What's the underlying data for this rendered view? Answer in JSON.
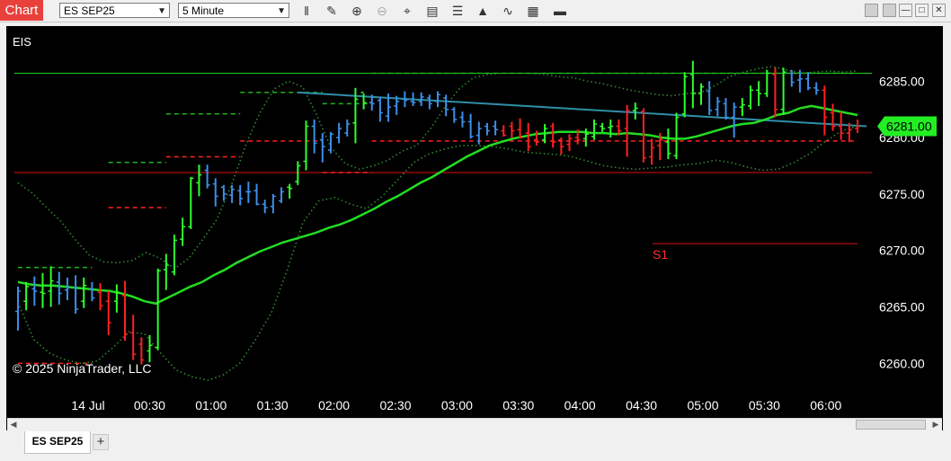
{
  "window": {
    "chart_label": "Chart",
    "instrument": "ES SEP25",
    "interval": "5 Minute",
    "toolbar_icons": [
      "bar-type-icon",
      "draw-pencil-icon",
      "zoom-in-icon",
      "zoom-out-icon",
      "crosshair-icon",
      "data-box-icon",
      "properties-icon",
      "indicators-icon",
      "strategies-icon",
      "templates-icon",
      "overlay-icon"
    ],
    "win_buttons": [
      "minimize",
      "maximize",
      "close"
    ]
  },
  "chart": {
    "instrument_label": "EIS",
    "copyright": "© 2025 NinjaTrader, LLC",
    "current_price": "6281.00",
    "price_ticks": [
      "6285.00",
      "6280.00",
      "6275.00",
      "6270.00",
      "6265.00",
      "6260.00"
    ],
    "time_ticks": [
      "14 Jul",
      "00:30",
      "01:00",
      "01:30",
      "02:00",
      "02:30",
      "03:00",
      "03:30",
      "04:00",
      "04:30",
      "05:00",
      "05:30",
      "06:00"
    ],
    "level_label": "S1",
    "colors": {
      "up": "#2eff2e",
      "down": "#ff2020",
      "neutral": "#3d8ee8",
      "ma": "#22dd22",
      "band": "#2f8a2f",
      "trend": "#2f8fa8",
      "hline": "#d11",
      "badge": "#22ee22"
    }
  },
  "chart_data": {
    "type": "candlestick",
    "y_range": [
      6257.4,
      6289.8
    ],
    "bar_count": 69,
    "bars": [
      {
        "o": 6264.6,
        "h": 6266.8,
        "l": 6262.9,
        "c": 6266.4,
        "d": "neutral"
      },
      {
        "o": 6265.5,
        "h": 6267.2,
        "l": 6264.7,
        "c": 6266.8,
        "d": "up"
      },
      {
        "o": 6266.6,
        "h": 6267.7,
        "l": 6265.1,
        "c": 6266.4,
        "d": "neutral"
      },
      {
        "o": 6266.3,
        "h": 6268.0,
        "l": 6264.9,
        "c": 6266.2,
        "d": "up"
      },
      {
        "o": 6266.4,
        "h": 6268.6,
        "l": 6265.0,
        "c": 6267.3,
        "d": "up"
      },
      {
        "o": 6267.2,
        "h": 6268.1,
        "l": 6265.2,
        "c": 6266.2,
        "d": "neutral"
      },
      {
        "o": 6266.5,
        "h": 6267.6,
        "l": 6265.6,
        "c": 6266.7,
        "d": "neutral"
      },
      {
        "o": 6266.7,
        "h": 6267.8,
        "l": 6264.4,
        "c": 6264.8,
        "d": "neutral"
      },
      {
        "o": 6265.5,
        "h": 6267.6,
        "l": 6264.9,
        "c": 6266.9,
        "d": "up"
      },
      {
        "o": 6266.6,
        "h": 6267.2,
        "l": 6265.5,
        "c": 6265.8,
        "d": "neutral"
      },
      {
        "o": 6266.3,
        "h": 6267.1,
        "l": 6264.7,
        "c": 6265.1,
        "d": "down"
      },
      {
        "o": 6265.5,
        "h": 6266.4,
        "l": 6262.5,
        "c": 6263.6,
        "d": "down"
      },
      {
        "o": 6265.5,
        "h": 6267.0,
        "l": 6264.5,
        "c": 6266.3,
        "d": "up"
      },
      {
        "o": 6266.0,
        "h": 6267.3,
        "l": 6262.0,
        "c": 6262.6,
        "d": "down"
      },
      {
        "o": 6262.7,
        "h": 6264.3,
        "l": 6260.3,
        "c": 6260.8,
        "d": "down"
      },
      {
        "o": 6261.7,
        "h": 6262.3,
        "l": 6259.9,
        "c": 6260.3,
        "d": "down"
      },
      {
        "o": 6261.1,
        "h": 6262.5,
        "l": 6260.1,
        "c": 6261.6,
        "d": "up"
      },
      {
        "o": 6261.4,
        "h": 6268.4,
        "l": 6261.2,
        "c": 6268.2,
        "d": "up"
      },
      {
        "o": 6268.3,
        "h": 6269.7,
        "l": 6266.5,
        "c": 6268.7,
        "d": "up"
      },
      {
        "o": 6268.1,
        "h": 6271.4,
        "l": 6267.8,
        "c": 6270.9,
        "d": "up"
      },
      {
        "o": 6271.0,
        "h": 6272.9,
        "l": 6270.4,
        "c": 6272.1,
        "d": "up"
      },
      {
        "o": 6272.1,
        "h": 6276.5,
        "l": 6271.9,
        "c": 6276.4,
        "d": "up"
      },
      {
        "o": 6276.0,
        "h": 6277.6,
        "l": 6274.8,
        "c": 6276.7,
        "d": "up"
      },
      {
        "o": 6277.1,
        "h": 6277.6,
        "l": 6275.5,
        "c": 6275.8,
        "d": "neutral"
      },
      {
        "o": 6275.9,
        "h": 6276.4,
        "l": 6273.9,
        "c": 6274.8,
        "d": "neutral"
      },
      {
        "o": 6275.6,
        "h": 6275.8,
        "l": 6274.4,
        "c": 6275.0,
        "d": "neutral"
      },
      {
        "o": 6274.9,
        "h": 6275.8,
        "l": 6274.2,
        "c": 6275.4,
        "d": "neutral"
      },
      {
        "o": 6275.3,
        "h": 6275.8,
        "l": 6274.0,
        "c": 6274.6,
        "d": "neutral"
      },
      {
        "o": 6275.2,
        "h": 6276.1,
        "l": 6274.2,
        "c": 6275.2,
        "d": "neutral"
      },
      {
        "o": 6275.3,
        "h": 6275.9,
        "l": 6274.0,
        "c": 6274.1,
        "d": "neutral"
      },
      {
        "o": 6274.1,
        "h": 6274.5,
        "l": 6273.3,
        "c": 6273.8,
        "d": "neutral"
      },
      {
        "o": 6273.9,
        "h": 6275.0,
        "l": 6273.3,
        "c": 6274.8,
        "d": "neutral"
      },
      {
        "o": 6274.4,
        "h": 6275.6,
        "l": 6274.2,
        "c": 6275.2,
        "d": "neutral"
      },
      {
        "o": 6275.6,
        "h": 6275.9,
        "l": 6274.6,
        "c": 6275.5,
        "d": "up"
      },
      {
        "o": 6276.1,
        "h": 6277.9,
        "l": 6275.8,
        "c": 6277.5,
        "d": "up"
      },
      {
        "o": 6277.9,
        "h": 6281.5,
        "l": 6277.1,
        "c": 6281.0,
        "d": "up"
      },
      {
        "o": 6281.0,
        "h": 6281.6,
        "l": 6278.6,
        "c": 6279.5,
        "d": "neutral"
      },
      {
        "o": 6279.8,
        "h": 6280.4,
        "l": 6277.8,
        "c": 6279.2,
        "d": "neutral"
      },
      {
        "o": 6278.9,
        "h": 6280.5,
        "l": 6278.6,
        "c": 6280.3,
        "d": "neutral"
      },
      {
        "o": 6280.0,
        "h": 6281.3,
        "l": 6279.5,
        "c": 6280.8,
        "d": "neutral"
      },
      {
        "o": 6280.4,
        "h": 6281.6,
        "l": 6280.1,
        "c": 6281.2,
        "d": "neutral"
      },
      {
        "o": 6281.3,
        "h": 6284.4,
        "l": 6279.5,
        "c": 6283.4,
        "d": "up"
      },
      {
        "o": 6284.0,
        "h": 6283.9,
        "l": 6282.5,
        "c": 6283.1,
        "d": "up"
      },
      {
        "o": 6283.1,
        "h": 6283.8,
        "l": 6282.4,
        "c": 6283.0,
        "d": "neutral"
      },
      {
        "o": 6283.3,
        "h": 6283.6,
        "l": 6281.4,
        "c": 6282.2,
        "d": "neutral"
      },
      {
        "o": 6281.9,
        "h": 6283.9,
        "l": 6281.4,
        "c": 6282.7,
        "d": "neutral"
      },
      {
        "o": 6282.8,
        "h": 6283.7,
        "l": 6282.0,
        "c": 6283.2,
        "d": "neutral"
      },
      {
        "o": 6283.4,
        "h": 6284.1,
        "l": 6282.7,
        "c": 6283.3,
        "d": "neutral"
      },
      {
        "o": 6283.2,
        "h": 6284.0,
        "l": 6282.8,
        "c": 6283.1,
        "d": "neutral"
      },
      {
        "o": 6283.2,
        "h": 6284.0,
        "l": 6282.8,
        "c": 6283.6,
        "d": "neutral"
      },
      {
        "o": 6283.5,
        "h": 6283.8,
        "l": 6282.5,
        "c": 6283.0,
        "d": "neutral"
      },
      {
        "o": 6283.2,
        "h": 6284.1,
        "l": 6282.7,
        "c": 6283.8,
        "d": "neutral"
      },
      {
        "o": 6283.5,
        "h": 6283.8,
        "l": 6281.9,
        "c": 6282.5,
        "d": "neutral"
      },
      {
        "o": 6282.5,
        "h": 6282.7,
        "l": 6281.3,
        "c": 6281.6,
        "d": "neutral"
      },
      {
        "o": 6281.8,
        "h": 6282.3,
        "l": 6280.9,
        "c": 6281.4,
        "d": "neutral"
      },
      {
        "o": 6281.4,
        "h": 6282.1,
        "l": 6279.9,
        "c": 6280.1,
        "d": "neutral"
      },
      {
        "o": 6280.2,
        "h": 6281.4,
        "l": 6279.4,
        "c": 6280.8,
        "d": "neutral"
      },
      {
        "o": 6281.0,
        "h": 6281.3,
        "l": 6280.2,
        "c": 6280.6,
        "d": "neutral"
      },
      {
        "o": 6281.0,
        "h": 6281.5,
        "l": 6280.2,
        "c": 6280.7,
        "d": "neutral"
      },
      {
        "o": 6280.6,
        "h": 6281.1,
        "l": 6280.1,
        "c": 6280.2,
        "d": "down"
      },
      {
        "o": 6281.0,
        "h": 6281.4,
        "l": 6280.0,
        "c": 6280.6,
        "d": "down"
      },
      {
        "o": 6280.7,
        "h": 6281.7,
        "l": 6279.9,
        "c": 6280.0,
        "d": "down"
      },
      {
        "o": 6280.4,
        "h": 6281.3,
        "l": 6278.8,
        "c": 6279.2,
        "d": "down"
      },
      {
        "o": 6279.8,
        "h": 6280.6,
        "l": 6279.3,
        "c": 6279.6,
        "d": "down"
      },
      {
        "o": 6279.8,
        "h": 6281.2,
        "l": 6279.5,
        "c": 6280.8,
        "d": "up"
      },
      {
        "o": 6281.0,
        "h": 6281.3,
        "l": 6279.1,
        "c": 6279.6,
        "d": "down"
      },
      {
        "o": 6279.8,
        "h": 6280.0,
        "l": 6278.5,
        "c": 6279.2,
        "d": "down"
      },
      {
        "o": 6279.4,
        "h": 6280.3,
        "l": 6278.8,
        "c": 6279.9,
        "d": "down"
      },
      {
        "o": 6280.0,
        "h": 6280.7,
        "l": 6279.4,
        "c": 6279.8,
        "d": "down"
      }
    ],
    "bars2": [
      {
        "o": 6279.9,
        "h": 6280.8,
        "l": 6279.2,
        "c": 6280.3,
        "d": "up"
      },
      {
        "o": 6280.1,
        "h": 6281.6,
        "l": 6279.8,
        "c": 6281.2,
        "d": "up"
      },
      {
        "o": 6281.0,
        "h": 6281.3,
        "l": 6280.5,
        "c": 6280.8,
        "d": "up"
      },
      {
        "o": 6280.9,
        "h": 6281.6,
        "l": 6280.0,
        "c": 6281.0,
        "d": "up"
      },
      {
        "o": 6281.0,
        "h": 6281.6,
        "l": 6280.2,
        "c": 6280.6,
        "d": "down"
      },
      {
        "o": 6280.8,
        "h": 6282.9,
        "l": 6278.3,
        "c": 6282.4,
        "d": "down"
      },
      {
        "o": 6282.4,
        "h": 6283.1,
        "l": 6281.6,
        "c": 6282.6,
        "d": "up"
      },
      {
        "o": 6282.3,
        "h": 6282.6,
        "l": 6277.8,
        "c": 6278.2,
        "d": "down"
      },
      {
        "o": 6278.3,
        "h": 6279.9,
        "l": 6277.6,
        "c": 6279.1,
        "d": "down"
      },
      {
        "o": 6279.3,
        "h": 6280.4,
        "l": 6278.0,
        "c": 6279.8,
        "d": "down"
      },
      {
        "o": 6279.6,
        "h": 6280.8,
        "l": 6278.1,
        "c": 6278.6,
        "d": "up"
      },
      {
        "o": 6278.4,
        "h": 6282.2,
        "l": 6278.1,
        "c": 6281.8,
        "d": "up"
      },
      {
        "o": 6282.1,
        "h": 6285.8,
        "l": 6281.8,
        "c": 6285.4,
        "d": "up"
      },
      {
        "o": 6285.6,
        "h": 6286.8,
        "l": 6282.6,
        "c": 6283.9,
        "d": "up"
      },
      {
        "o": 6283.9,
        "h": 6284.8,
        "l": 6282.9,
        "c": 6284.5,
        "d": "up"
      },
      {
        "o": 6284.1,
        "h": 6285.0,
        "l": 6282.0,
        "c": 6282.4,
        "d": "neutral"
      },
      {
        "o": 6282.5,
        "h": 6283.6,
        "l": 6281.9,
        "c": 6283.2,
        "d": "neutral"
      },
      {
        "o": 6283.0,
        "h": 6283.5,
        "l": 6281.6,
        "c": 6281.8,
        "d": "neutral"
      },
      {
        "o": 6281.8,
        "h": 6283.1,
        "l": 6280.0,
        "c": 6282.7,
        "d": "neutral"
      },
      {
        "o": 6282.7,
        "h": 6283.5,
        "l": 6281.9,
        "c": 6282.9,
        "d": "up"
      },
      {
        "o": 6282.8,
        "h": 6284.6,
        "l": 6282.5,
        "c": 6284.2,
        "d": "up"
      },
      {
        "o": 6284.2,
        "h": 6285.0,
        "l": 6282.8,
        "c": 6283.9,
        "d": "up"
      },
      {
        "o": 6283.9,
        "h": 6286.0,
        "l": 6283.6,
        "c": 6285.7,
        "d": "up"
      },
      {
        "o": 6285.6,
        "h": 6286.2,
        "l": 6281.8,
        "c": 6282.5,
        "d": "down"
      },
      {
        "o": 6282.5,
        "h": 6286.2,
        "l": 6282.0,
        "c": 6285.8,
        "d": "up"
      },
      {
        "o": 6285.7,
        "h": 6286.0,
        "l": 6284.5,
        "c": 6284.9,
        "d": "neutral"
      },
      {
        "o": 6285.1,
        "h": 6286.0,
        "l": 6284.0,
        "c": 6285.2,
        "d": "neutral"
      },
      {
        "o": 6285.2,
        "h": 6285.8,
        "l": 6284.2,
        "c": 6284.4,
        "d": "neutral"
      },
      {
        "o": 6284.4,
        "h": 6284.9,
        "l": 6283.8,
        "c": 6284.2,
        "d": "neutral"
      },
      {
        "o": 6284.2,
        "h": 6284.6,
        "l": 6280.2,
        "c": 6281.8,
        "d": "down"
      },
      {
        "o": 6282.2,
        "h": 6283.0,
        "l": 6280.6,
        "c": 6281.0,
        "d": "down"
      },
      {
        "o": 6281.0,
        "h": 6282.3,
        "l": 6279.8,
        "c": 6280.4,
        "d": "down"
      },
      {
        "o": 6280.4,
        "h": 6281.3,
        "l": 6279.6,
        "c": 6280.7,
        "d": "down"
      },
      {
        "o": 6280.8,
        "h": 6281.6,
        "l": 6280.4,
        "c": 6281.0,
        "d": "down"
      }
    ],
    "ma": [
      6267.2,
      6267.0,
      6266.9,
      6266.9,
      6266.8,
      6266.7,
      6266.6,
      6266.5,
      6266.4,
      6266.2,
      6265.9,
      6265.5,
      6265.3,
      6265.8,
      6266.3,
      6266.8,
      6267.2,
      6267.8,
      6268.3,
      6268.9,
      6269.4,
      6269.9,
      6270.3,
      6270.7,
      6271.0,
      6271.3,
      6271.6,
      6272.0,
      6272.3,
      6272.7,
      6273.2,
      6273.7,
      6274.3,
      6274.8,
      6275.4,
      6276.0,
      6276.5,
      6277.1,
      6277.7,
      6278.3,
      6278.8,
      6279.3,
      6279.6,
      6279.9,
      6280.1,
      6280.3,
      6280.4,
      6280.5,
      6280.5,
      6280.5,
      6280.4,
      6280.4,
      6280.3,
      6280.4,
      6280.3,
      6280.2,
      6280.0,
      6279.9,
      6279.9,
      6280.1,
      6280.4,
      6280.7,
      6281.0,
      6281.2,
      6281.3,
      6281.6,
      6282.0,
      6282.2,
      6282.6,
      6282.8,
      6282.6,
      6282.4,
      6282.2,
      6282.0
    ],
    "upper_band": [
      6276.0,
      6275.1,
      6273.8,
      6272.6,
      6271.0,
      6269.6,
      6269.0,
      6268.9,
      6269.1,
      6269.8,
      6269.3,
      6268.4,
      6269.3,
      6271.0,
      6272.8,
      6275.8,
      6279.3,
      6282.2,
      6284.3,
      6285.0,
      6284.5,
      6282.0,
      6279.1,
      6277.7,
      6277.2,
      6277.5,
      6278.0,
      6278.8,
      6279.3,
      6280.8,
      6282.7,
      6284.3,
      6285.3,
      6285.6,
      6285.7,
      6285.7,
      6285.7,
      6285.6,
      6285.4,
      6285.3,
      6285.0,
      6284.8,
      6284.5,
      6284.2,
      6284.0,
      6283.8,
      6283.7,
      6283.9,
      6284.0,
      6284.6,
      6285.4,
      6285.8,
      6286.1,
      6286.3,
      6286.0,
      6285.7,
      6285.8,
      6285.9,
      6285.8,
      6285.9
    ],
    "lower_band": [
      6265.4,
      6262.1,
      6260.9,
      6260.3,
      6260.0,
      6260.2,
      6261.4,
      6262.8,
      6262.6,
      6260.9,
      6259.4,
      6258.8,
      6258.5,
      6259.0,
      6260.0,
      6262.1,
      6264.5,
      6268.3,
      6272.5,
      6274.4,
      6274.7,
      6274.1,
      6273.7,
      6274.8,
      6276.3,
      6277.8,
      6278.6,
      6279.0,
      6279.3,
      6279.3,
      6279.2,
      6279.0,
      6278.7,
      6278.6,
      6278.5,
      6278.3,
      6277.9,
      6277.5,
      6277.3,
      6277.2,
      6277.3,
      6277.4,
      6277.6,
      6277.7,
      6278.0,
      6277.8,
      6277.4,
      6277.1,
      6277.2,
      6277.8,
      6278.6,
      6279.7,
      6280.6,
      6281.0
    ],
    "trend_line": {
      "start": 6284.0,
      "end": 6281.0
    },
    "horizontal_lines": [
      {
        "price": 6285.7,
        "style": "solid",
        "color": "green"
      },
      {
        "price": 6276.9,
        "style": "solid",
        "color": "red"
      },
      {
        "price": 6270.6,
        "style": "solid",
        "color": "red",
        "label": "S1"
      }
    ],
    "dashed_levels": [
      {
        "price": 6268.5,
        "color": "green"
      },
      {
        "price": 6260.0,
        "color": "red"
      },
      {
        "price": 6277.8,
        "color": "green"
      },
      {
        "price": 6273.8,
        "color": "red"
      },
      {
        "price": 6282.1,
        "color": "green"
      },
      {
        "price": 6278.3,
        "color": "red"
      },
      {
        "price": 6284.0,
        "color": "green"
      },
      {
        "price": 6279.7,
        "color": "red"
      },
      {
        "price": 6283.0,
        "color": "green"
      },
      {
        "price": 6276.9,
        "color": "red"
      },
      {
        "price": 6285.7,
        "color": "green"
      },
      {
        "price": 6279.7,
        "color": "red"
      }
    ]
  }
}
